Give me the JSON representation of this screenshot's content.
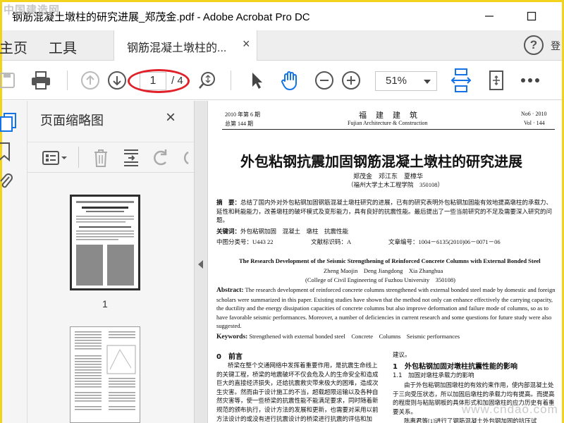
{
  "window": {
    "title": "钢筋混凝土墩柱的研究进展_郑茂金.pdf - Adobe Acrobat Pro DC",
    "watermark_top": "中国建造网",
    "watermark_bottom": "www.cndao.com"
  },
  "menu": {
    "home": "主页",
    "tools": "工具",
    "tab_label": "钢筋混凝土墩柱的...",
    "tab_close": "×",
    "help": "?",
    "signin": "登"
  },
  "toolbar": {
    "page_current": "1",
    "page_total": "/ 4",
    "zoom": "51%"
  },
  "thumbnails": {
    "title": "页面缩略图",
    "close": "×",
    "page_label": "1"
  },
  "doc": {
    "header_left_1": "2010 年第 6 期",
    "header_left_2": "总第 144 期",
    "journal_cn": "福　建　建　筑",
    "journal_en": "Fujian Architecture & Construction",
    "header_right_1": "No6 · 2010",
    "header_right_2": "Vol · 144",
    "title_cn": "外包粘钢抗震加固钢筋混凝土墩柱的研究进展",
    "authors_cn": "郑茂金　邓江东　夏樟华",
    "affil_cn": "（福州大学土木工程学院　350108）",
    "abstract_label": "摘　要：",
    "abstract_cn": "总结了国内外对外包粘钢加固钢筋混凝土墩柱研究的进展，已有的研究表明外包粘钢加固能有效地提高墩柱的承载力、延性和耗能能力，改善墩柱的破坏模式及变形能力，具有良好的抗震性能。最后提出了一些当前研究的不足及需要深入研究的问题。",
    "keywords_label": "关键词：",
    "keywords_cn": "外包粘钢加固　混凝土　墩柱　抗震性能",
    "clc": "中图分类号：U443 22",
    "doc_code": "文献标识码：A",
    "article_no": "文章编号：1004－6135(2010)06－0071－06",
    "title_en": "The Research Development of the Seismic Strengthening of Reinforced Concrete Columns with External Bonded Steel",
    "authors_en": "Zheng Maojin　Deng Jiangdong　Xia Zhanghua",
    "affil_en": "(College of Civil Engineering of Fuzhou University　350108)",
    "abstract_en_label": "Abstract:",
    "abstract_en": "The research development of reinforced concrete columns strengthened with external bonded steel made by domestic and foreign scholars were summarized in this paper. Existing studies have shown that the method not only can enhance effectively the carrying capacity, the ductility and the energy dissipation capacities of concrete columns but also improve deformation and failure mode of columns, so as to have favorable seismic performances. Moreover, a number of deficiencies in current research and some questions for future study were also suggested.",
    "keywords_en_label": "Keywords:",
    "keywords_en": "Strengthened with external bonded steel　Concrete　Columns　Seismic performances",
    "sec0_title": "0　前言",
    "sec0_body": "桥梁在整个交通网络中发挥着重要作用，是抗震生命线上的关键工程，桥梁的地震破坏不仅会危及人的生命安全和造成巨大的直接经济损失，还给抗震救灾带来极大的困难，造成次生灾害。然而由于设计施工的不当，超载超限运输以及各种自然灾害等，使一些桥梁的抗震性能不能满足要求，同时随着新规范的颁布执行，设计方法的发展和更新，也需要对采用以前方法设计的或没有进行抗震设计的桥梁进行抗震的评估和加",
    "col2_line1": "建议。",
    "sec1_title": "1　外包粘钢加固对墩柱抗震性能的影响",
    "sec11_title": "1.1　加固对墩柱承载力的影响",
    "col2_body": "由于外包粘钢加固墩柱的有效约束作用，使内部混凝土处于三向受压状态，所以加固后墩柱的承载力均有提高。而提高的程度则与粘贴钢板的具体形式和加固墩柱的应力历史有着重要关系。",
    "col2_last": "陈惠君等[1]进行了钢筋混凝土外包钢加固的抗压试"
  }
}
